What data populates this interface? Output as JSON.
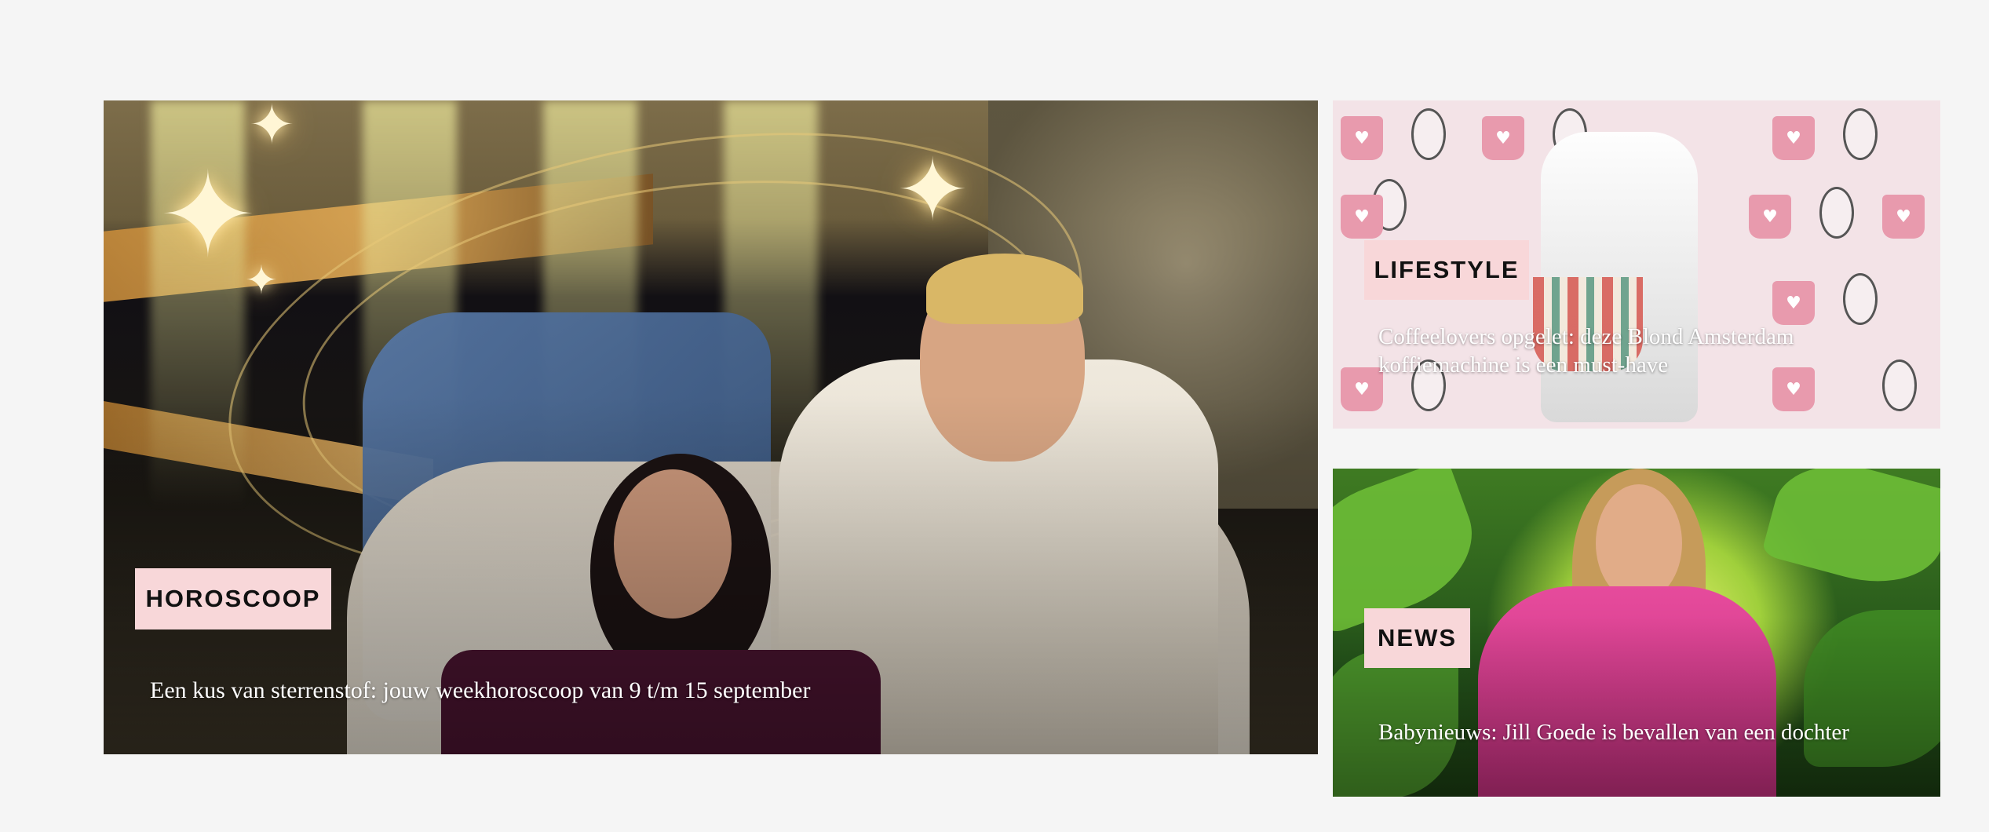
{
  "cards": [
    {
      "category": "HOROSCOOP",
      "title": "Een kus van sterrenstof: jouw weekhoroscoop van 9 t/m 15 september"
    },
    {
      "category": "LIFESTYLE",
      "title": "Coffeelovers opgelet: deze Blond Amsterdam koffiemachine is een must-have"
    },
    {
      "category": "NEWS",
      "title": "Babynieuws: Jill Goede is bevallen van een dochter"
    }
  ],
  "colors": {
    "page_background": "#f5f5f5",
    "badge_background": "#f8d7d9",
    "badge_text": "#111111",
    "title_text": "#ffffff"
  }
}
